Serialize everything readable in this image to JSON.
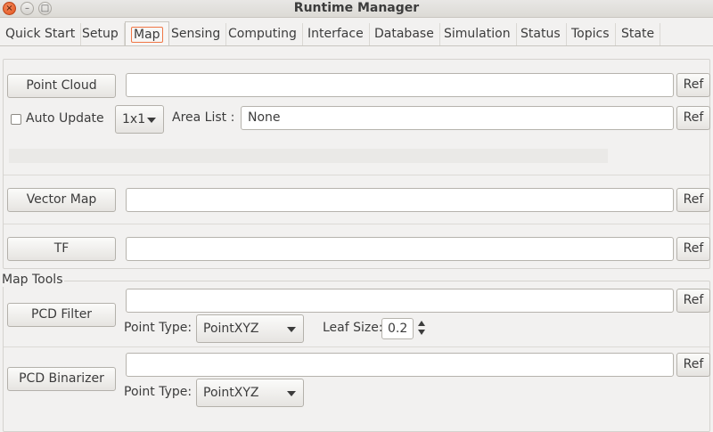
{
  "window": {
    "title": "Runtime Manager",
    "close_glyph": "×",
    "min_glyph": "–",
    "max_glyph": "□"
  },
  "tabs": [
    "Quick Start",
    "Setup",
    "Map",
    "Sensing",
    "Computing",
    "Interface",
    "Database",
    "Simulation",
    "Status",
    "Topics",
    "State"
  ],
  "active_tab": "Map",
  "point_cloud": {
    "button": "Point Cloud",
    "path": "",
    "ref": "Ref",
    "auto_update_label": "Auto Update",
    "auto_update_checked": false,
    "grid_select": "1x1",
    "area_list_label": "Area List :",
    "area_list_value": "None",
    "area_ref": "Ref",
    "progress": 0
  },
  "vector_map": {
    "button": "Vector Map",
    "path": "",
    "ref": "Ref"
  },
  "tf": {
    "button": "TF",
    "path": "",
    "ref": "Ref"
  },
  "map_tools": {
    "title": "Map Tools",
    "pcd_filter": {
      "button": "PCD Filter",
      "path": "",
      "ref": "Ref",
      "point_type_label": "Point Type:",
      "point_type": "PointXYZ",
      "leaf_size_label": "Leaf Size:",
      "leaf_size": "0.2"
    },
    "pcd_binarizer": {
      "button": "PCD Binarizer",
      "path": "",
      "ref": "Ref",
      "point_type_label": "Point Type:",
      "point_type": "PointXYZ"
    }
  },
  "colors": {
    "accent": "#f07746",
    "background": "#f2f1f0"
  }
}
